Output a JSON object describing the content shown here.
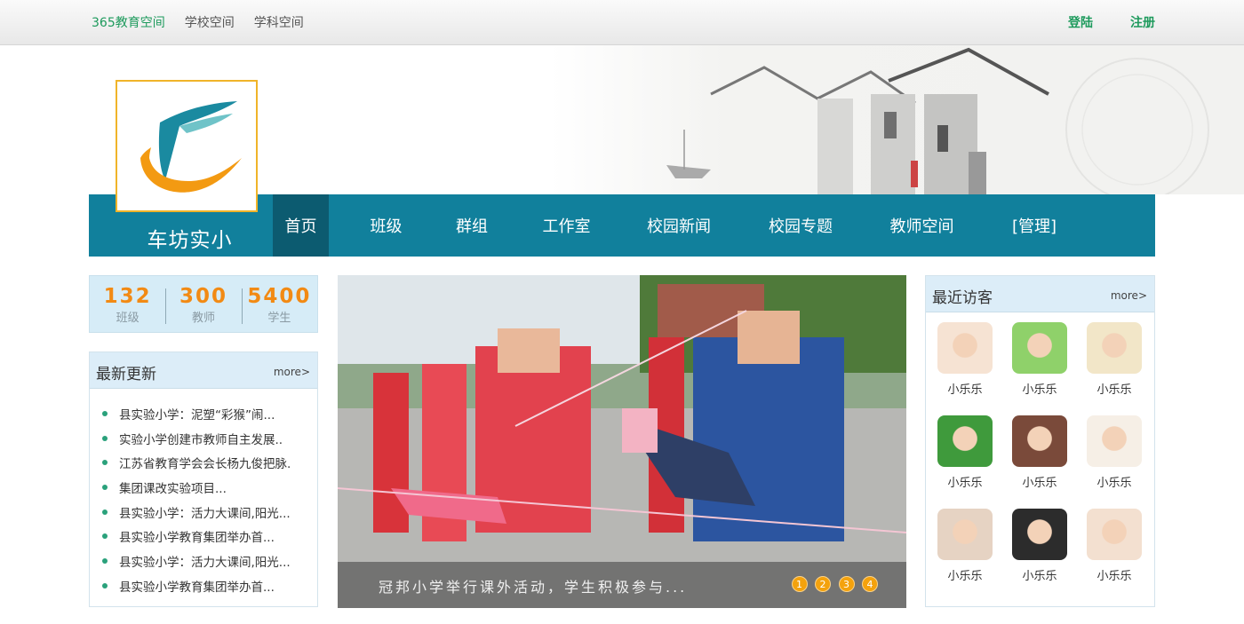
{
  "topbar": {
    "links": [
      "365教育空间",
      "学校空间",
      "学科空间"
    ],
    "login": "登陆",
    "register": "注册"
  },
  "school": {
    "name": "车坊实小"
  },
  "nav": {
    "items": [
      "首页",
      "班级",
      "群组",
      "工作室",
      "校园新闻",
      "校园专题",
      "教师空间",
      "[管理]"
    ]
  },
  "stats": [
    {
      "value": "132",
      "label": "班级"
    },
    {
      "value": "300",
      "label": "教师"
    },
    {
      "value": "5400",
      "label": "学生"
    }
  ],
  "news": {
    "title": "最新更新",
    "more": "more>",
    "items": [
      "县实验小学：泥塑“彩猴”闹...",
      "实验小学创建市教师自主发展..",
      "江苏省教育学会会长杨九俊把脉.",
      "集团课改实验项目...",
      "县实验小学：活力大课间,阳光...",
      "县实验小学教育集团举办首...",
      "县实验小学：活力大课间,阳光...",
      "县实验小学教育集团举办首..."
    ]
  },
  "slideshow": {
    "caption": "冠邦小学举行课外活动，学生积极参与...",
    "pages": [
      "1",
      "2",
      "3",
      "4"
    ]
  },
  "visitors": {
    "title": "最近访客",
    "more": "more>",
    "items": [
      {
        "name": "小乐乐",
        "color": "#f6e3d3"
      },
      {
        "name": "小乐乐",
        "color": "#8fd16a"
      },
      {
        "name": "小乐乐",
        "color": "#f2e6c8"
      },
      {
        "name": "小乐乐",
        "color": "#3f9a3c"
      },
      {
        "name": "小乐乐",
        "color": "#7a4a3a"
      },
      {
        "name": "小乐乐",
        "color": "#f6efe6"
      },
      {
        "name": "小乐乐",
        "color": "#e6d3c3"
      },
      {
        "name": "小乐乐",
        "color": "#2c2c2c"
      },
      {
        "name": "小乐乐",
        "color": "#f3e0d0"
      }
    ]
  },
  "colors": {
    "accent_green": "#1d9a5c",
    "nav_blue": "#11809c",
    "nav_active": "#0c5b70",
    "stat_orange": "#f28a14",
    "pager_orange": "#f4a20d"
  }
}
